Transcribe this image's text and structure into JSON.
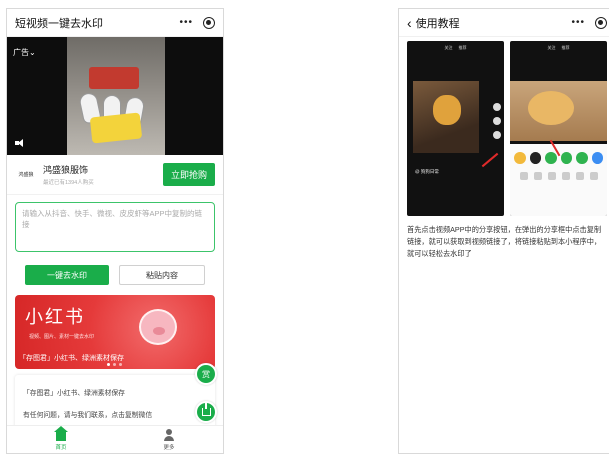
{
  "left": {
    "nav_title": "短视频一键去水印",
    "ad_tag": "广告⌄",
    "promo_sticker": "",
    "brand": {
      "logo_text": "鸿盛狼",
      "name": "鸿盛狼服饰",
      "sub": "最近已有1394人购买",
      "buy_label": "立即抢购"
    },
    "input_placeholder": "请输入从抖音、快手、微视、皮皮虾等APP中复制的链接",
    "btn_remove": "一键去水印",
    "btn_paste": "粘贴内容",
    "banner": {
      "title": "小红书",
      "small": "视频、图片、素材一键去水印",
      "sub": "「存图君」小红书、绿洲素材保存"
    },
    "cards": [
      "「存图君」小红书、绿洲素材保存",
      "有任何问题，请与我们联系，点击复制微信"
    ],
    "fab_label": "赏",
    "tabs": [
      {
        "label": "首页"
      },
      {
        "label": "更多"
      }
    ]
  },
  "right": {
    "nav_title": "使用教程",
    "shot1": {
      "tab_a": "关注",
      "tab_b": "推荐",
      "caption": "@ 狗狗日常"
    },
    "shot2": {
      "tab_a": "关注",
      "tab_b": "推荐"
    },
    "tutorial_text": "首先点击视频APP中的分享按钮，在弹出的分享框中点击复制链接，就可以获取到视频链接了，将链接粘贴到本小程序中，就可以轻松去水印了"
  },
  "colors": {
    "accent": "#1aad4a",
    "banner": "#e53a3a"
  }
}
